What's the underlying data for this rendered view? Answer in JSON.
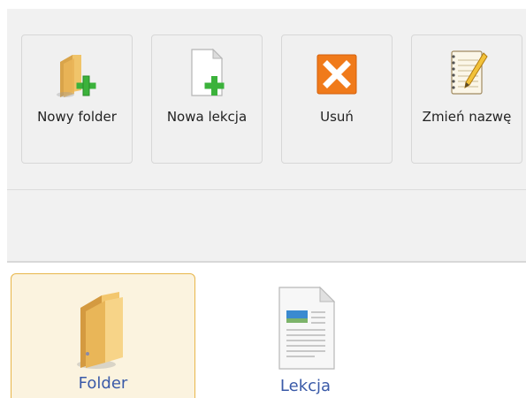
{
  "toolbar": {
    "buttons": [
      {
        "label": "Nowy folder",
        "icon": "new-folder-icon"
      },
      {
        "label": "Nowa lekcja",
        "icon": "new-lesson-icon"
      },
      {
        "label": "Usuń",
        "icon": "delete-icon"
      },
      {
        "label": "Zmień nazwę",
        "icon": "rename-icon"
      }
    ]
  },
  "items": [
    {
      "name": "Folder",
      "icon": "folder-icon",
      "selected": true
    },
    {
      "name": "Lekcja",
      "icon": "lesson-document-icon",
      "selected": false
    }
  ],
  "colors": {
    "panel": "#f1f1f1",
    "selection_border": "#e8b64a",
    "link_text": "#3a5aa8",
    "add_green": "#3bb23b",
    "delete_orange": "#f07a1a"
  }
}
